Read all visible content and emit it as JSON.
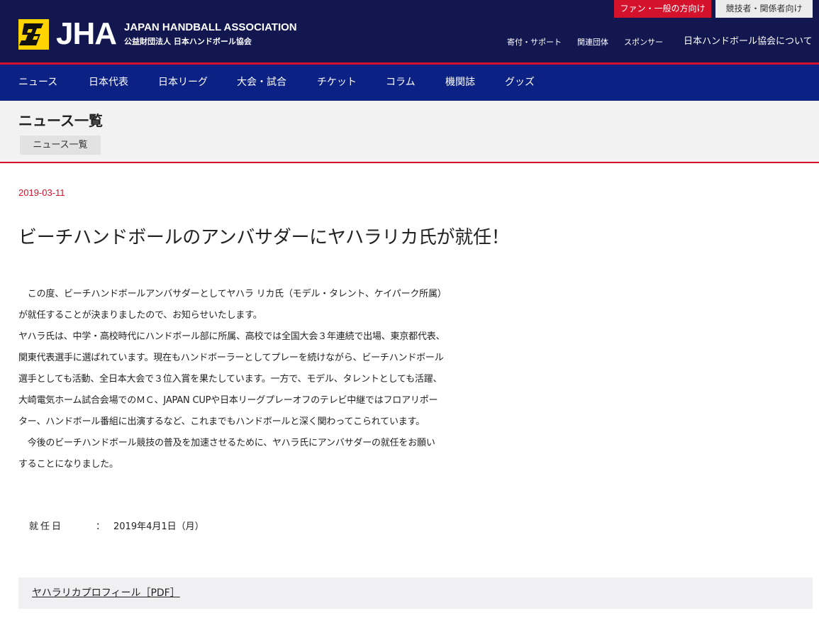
{
  "header": {
    "logo_text": "JHA",
    "org_name_en": "JAPAN HANDBALL ASSOCIATION",
    "org_name_ja": "公益財団法人 日本ハンドボール協会",
    "audience_fan": "ファン・一般の方向け",
    "audience_player": "競技者・関係者向け",
    "sub_nav": [
      "寄付・サポート",
      "関連団体",
      "スポンサー",
      "日本ハンドボール協会について"
    ],
    "colors": {
      "navy": "#12174f",
      "blue": "#0b2184",
      "red": "#d4122c",
      "yellow": "#ffd400"
    }
  },
  "main_nav": [
    "ニュース",
    "日本代表",
    "日本リーグ",
    "大会・試合",
    "チケット",
    "コラム",
    "機関誌",
    "グッズ"
  ],
  "section": {
    "title": "ニュース一覧",
    "breadcrumb": "ニュース一覧"
  },
  "article": {
    "date": "2019-03-11",
    "title": "ビーチハンドボールのアンバサダーにヤハラリカ氏が就任！",
    "body_lines": [
      "　この度、ビーチハンドボールアンバサダーとしてヤハラ リカ氏（モデル・タレント、ケイパーク所属）",
      "が就任することが決まりましたので、お知らせいたします。",
      "ヤハラ氏は、中学・高校時代にハンドボール部に所属、高校では全国大会３年連続で出場、東京都代表、",
      "関東代表選手に選ばれています。現在もハンドボーラーとしてプレーを続けながら、ビーチハンドボール",
      "選手としても活動、全日本大会で３位入賞を果たしています。一方で、モデル、タレントとしても活躍、",
      "大崎電気ホーム試合会場でのＭＣ、JAPAN CUPや日本リーグプレーオフのテレビ中継ではフロアリポー",
      "ター、ハンドボール番組に出演するなど、これまでもハンドボールと深く関わってこられています。",
      "　今後のビーチハンドボール競技の普及を加速させるために、ヤハラ氏にアンバサダーの就任をお願い",
      "することになりました。"
    ],
    "appointment_label": "就任日",
    "appointment_colon": "：",
    "appointment_date": "2019年4月1日（月）",
    "profile_link": "ヤハラリカプロフィール［PDF］"
  }
}
